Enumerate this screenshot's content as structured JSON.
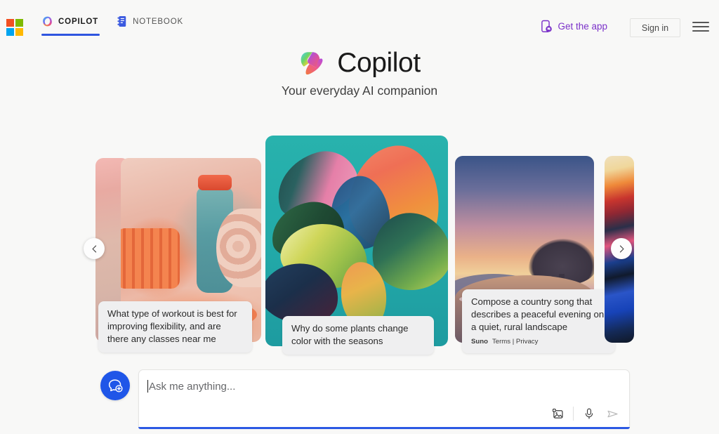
{
  "topbar": {
    "ms_logo_name": "microsoft-logo",
    "ms_logo_colors": [
      "#f25022",
      "#7fba00",
      "#00a4ef",
      "#ffb900"
    ],
    "tabs": [
      {
        "label": "COPILOT",
        "icon": "copilot-icon",
        "active": true
      },
      {
        "label": "NOTEBOOK",
        "icon": "notebook-icon",
        "active": false
      }
    ],
    "get_app": {
      "label": "Get the app",
      "icon": "phone-app-icon",
      "color": "#7b32c9"
    },
    "sign_in": {
      "label": "Sign in"
    },
    "menu": {
      "icon": "hamburger-menu-icon"
    },
    "active_tab_accent": "#2f55e0"
  },
  "hero": {
    "logo_icon": "copilot-logo",
    "title": "Copilot",
    "subtitle": "Your everyday AI companion"
  },
  "carousel": {
    "prev_label": "‹",
    "next_label": "›",
    "prev_icon": "chevron-left-icon",
    "next_icon": "chevron-right-icon",
    "cards": [
      {
        "id": "card-peach-partial",
        "image_alt": "soft pink and peach gradient",
        "caption": ""
      },
      {
        "id": "card-workout",
        "image_alt": "fitness still life with foam roller, teal water bottle, jump rope and yoga mat",
        "caption": "What type of workout is best for improving flexibility, and are there any classes near me"
      },
      {
        "id": "card-plants",
        "image_alt": "painted fiddle leaf fig plant with multicolored leaves on teal background",
        "caption": "Why do some plants change color with the seasons"
      },
      {
        "id": "card-landscape",
        "image_alt": "sunset over rolling hills with a lone tree silhouette",
        "caption": "Compose a country song that describes a peaceful evening on a quiet, rural landscape",
        "attribution": {
          "brand": "Suno",
          "links": "Terms | Privacy"
        }
      },
      {
        "id": "card-abstract-partial",
        "image_alt": "abstract painterly brush strokes in cream, orange, red, pink and blue",
        "caption": ""
      }
    ]
  },
  "composer": {
    "new_chat": {
      "icon": "new-chat-icon",
      "color": "#1f56e8"
    },
    "input": {
      "value": "",
      "placeholder": "Ask me anything...",
      "underline_color": "#2b59e3"
    },
    "actions": [
      {
        "icon": "add-image-icon",
        "name": "attach-image-button"
      },
      {
        "icon": "microphone-icon",
        "name": "voice-input-button"
      },
      {
        "icon": "send-icon",
        "name": "send-button"
      }
    ]
  }
}
